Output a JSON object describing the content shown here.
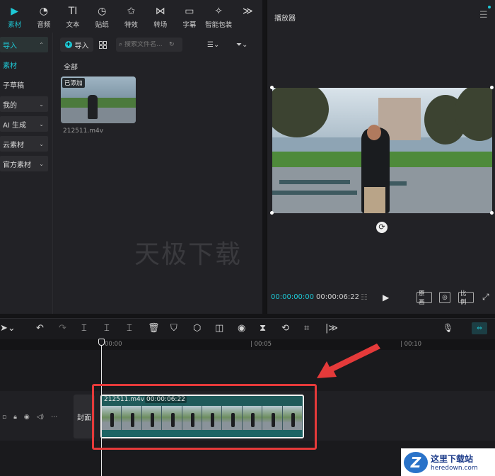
{
  "top_tabs": [
    {
      "label": "素材",
      "icon": "media-icon",
      "active": true
    },
    {
      "label": "音频",
      "icon": "audio-icon"
    },
    {
      "label": "文本",
      "icon": "text-icon"
    },
    {
      "label": "贴纸",
      "icon": "sticker-icon"
    },
    {
      "label": "特效",
      "icon": "effects-icon"
    },
    {
      "label": "转场",
      "icon": "transition-icon"
    },
    {
      "label": "字幕",
      "icon": "captions-icon"
    },
    {
      "label": "智能包装",
      "icon": "smart-pack-icon"
    }
  ],
  "more_glyph": "≫",
  "sidebar": {
    "items": [
      {
        "label": "导入",
        "chevron": "⌃"
      },
      {
        "label": "素材"
      },
      {
        "label": "子草稿"
      },
      {
        "label": "我的",
        "chevron": "⌄"
      },
      {
        "label": "AI 生成",
        "chevron": "⌄"
      },
      {
        "label": "云素材",
        "chevron": "⌄"
      },
      {
        "label": "官方素材",
        "chevron": "⌄"
      }
    ]
  },
  "media": {
    "import_label": "导入",
    "search_placeholder": "搜索文件名...",
    "section_label": "全部",
    "clip_badge": "已添加",
    "clip_name": "212511.m4v"
  },
  "watermark": "天极下载",
  "player": {
    "title": "播放器",
    "current_time": "00:00:00:00",
    "total_time": "00:00:06:22",
    "btn_original": "原画",
    "btn_ratio": "比例"
  },
  "timeline": {
    "ticks": [
      "00:00",
      "| 00:05",
      "| 00:10"
    ],
    "cover_label": "封面",
    "clip_name": "212511.m4v",
    "clip_duration": "00:00:06:22"
  },
  "logo": {
    "letter": "Z",
    "line1": "这里下载站",
    "line2": "heredown.com"
  },
  "colors": {
    "accent": "#1ec9d6",
    "highlight": "#e53a3a"
  }
}
